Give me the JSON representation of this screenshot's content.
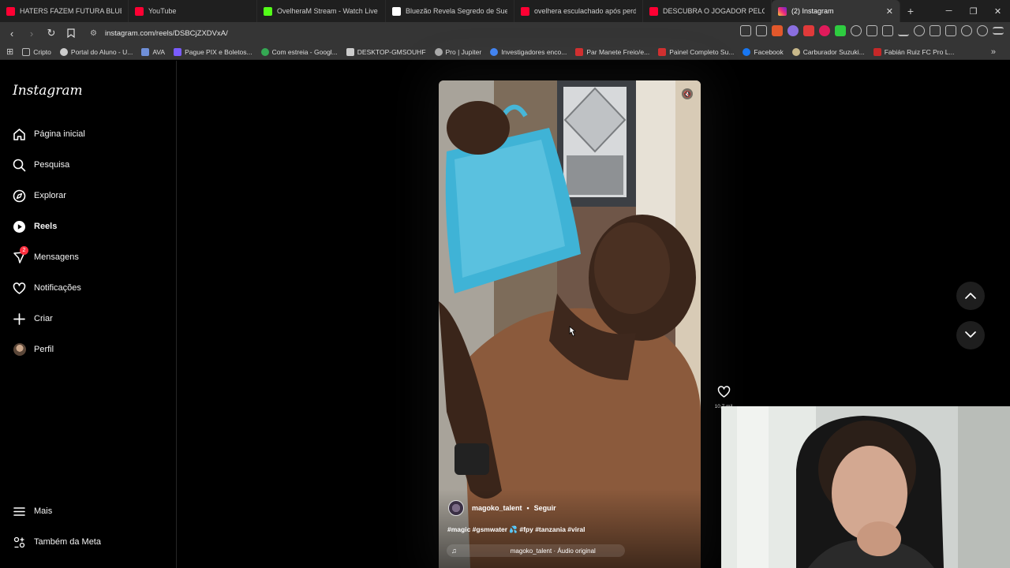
{
  "browser": {
    "tabs": [
      {
        "title": "HATERS FAZEM FUTURA BLUEZETE D",
        "favicon_color": "#ff0033"
      },
      {
        "title": "YouTube",
        "favicon_color": "#ff0033"
      },
      {
        "title": "OvelheraM Stream - Watch Live on K",
        "favicon_color": "#53fc18"
      },
      {
        "title": "Bluezão Revela Segredo de Suelen s",
        "favicon_color": "#ffffff"
      },
      {
        "title": "ovelhera esculachado após perder t",
        "favicon_color": "#ff0033"
      },
      {
        "title": "DESCUBRA O JOGADOR PELO CABE",
        "favicon_color": "#ff0033"
      },
      {
        "title": "(2) Instagram",
        "favicon_color": "#e1306c",
        "active": true
      }
    ],
    "new_tab": "+",
    "url": "instagram.com/reels/DSBCjZXDVxA/",
    "bookmarks": [
      {
        "label": "Cripto",
        "color": "#bbbbbb"
      },
      {
        "label": "Portal do Aluno - U...",
        "color": "#cccccc"
      },
      {
        "label": "AVA",
        "color": "#6f8fd8"
      },
      {
        "label": "Pague PIX e Boletos...",
        "color": "#7a5cff"
      },
      {
        "label": "Com estreia - Googl...",
        "color": "#34a853"
      },
      {
        "label": "DESKTOP-GMSOUHF",
        "color": "#cccccc"
      },
      {
        "label": "Pro | Jupiter",
        "color": "#aaaaaa"
      },
      {
        "label": "Investigadores enco...",
        "color": "#4285f4"
      },
      {
        "label": "Par Manete Freio/e...",
        "color": "#d32f2f"
      },
      {
        "label": "Painel Completo Su...",
        "color": "#d32f2f"
      },
      {
        "label": "Facebook",
        "color": "#1877f2"
      },
      {
        "label": "Carburador Suzuki...",
        "color": "#c8b88a"
      },
      {
        "label": "Fabián Ruiz FC Pro L...",
        "color": "#c62828"
      }
    ]
  },
  "instagram": {
    "logo": "Instagram",
    "nav": [
      {
        "label": "Página inicial",
        "icon": "home-icon"
      },
      {
        "label": "Pesquisa",
        "icon": "search-icon"
      },
      {
        "label": "Explorar",
        "icon": "compass-icon"
      },
      {
        "label": "Reels",
        "icon": "reels-icon",
        "active": true
      },
      {
        "label": "Mensagens",
        "icon": "messenger-icon",
        "badge": "2"
      },
      {
        "label": "Notificações",
        "icon": "heart-icon"
      },
      {
        "label": "Criar",
        "icon": "plus-icon"
      },
      {
        "label": "Perfil",
        "icon": "avatar"
      }
    ],
    "bottom_nav": [
      {
        "label": "Mais",
        "icon": "menu-icon"
      },
      {
        "label": "Também da Meta",
        "icon": "meta-icon"
      }
    ],
    "reel": {
      "username": "magoko_talent",
      "separator": "•",
      "follow": "Seguir",
      "hashtags": "#magic #gsmwater 💦 #fpy #tanzania #viral",
      "audio": "magoko_talent · Áudio original",
      "likes": "10,7 mil"
    }
  }
}
